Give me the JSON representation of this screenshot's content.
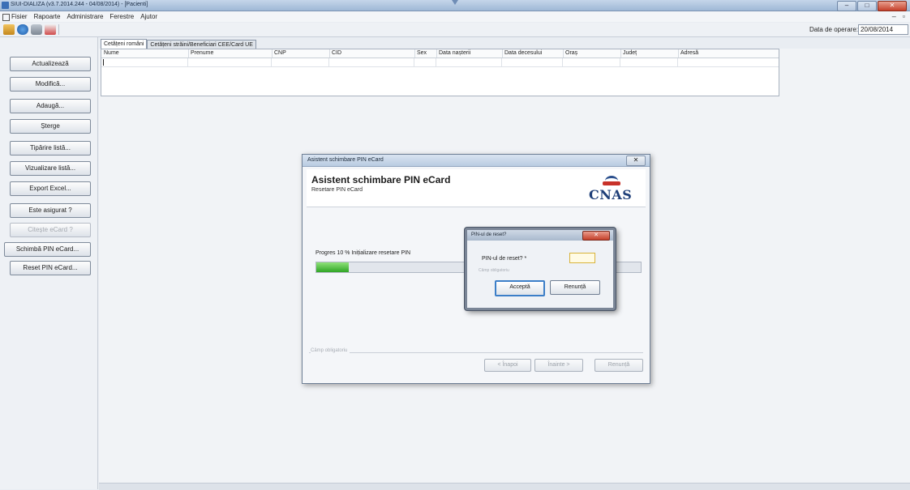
{
  "window": {
    "title": "SIUI-DIALIZA (v3.7.2014.244 - 04/08/2014) - [Pacienti]"
  },
  "menu": [
    "Fisier",
    "Rapoarte",
    "Administrare",
    "Ferestre",
    "Ajutor"
  ],
  "toolbar": {
    "operation_date_label": "Data de operare:",
    "operation_date_value": "20/08/2014"
  },
  "sidebar": {
    "items": [
      {
        "label": "Actualizează",
        "enabled": true
      },
      {
        "label": "Modifică...",
        "enabled": true
      },
      {
        "label": "Adaugă...",
        "enabled": true
      },
      {
        "label": "Șterge",
        "enabled": true
      },
      {
        "label": "Tipărire listă...",
        "enabled": true
      },
      {
        "label": "Vizualizare listă...",
        "enabled": true
      },
      {
        "label": "Export Excel...",
        "enabled": true
      },
      {
        "label": "Este asigurat ?",
        "enabled": true
      },
      {
        "label": "Citește eCard ?",
        "enabled": false
      },
      {
        "label": "Schimbă PIN eCard...",
        "enabled": true
      },
      {
        "label": "Reset PIN eCard...",
        "enabled": true
      }
    ]
  },
  "tabs": [
    {
      "label": "Cetățeni români",
      "active": true
    },
    {
      "label": "Cetățeni străini/Beneficiari CEE/Card UE",
      "active": false
    }
  ],
  "grid": {
    "columns": [
      "Nume",
      "Prenume",
      "CNP",
      "CID",
      "Sex",
      "Data nașterii",
      "Data decesului",
      "Oraș",
      "Județ",
      "Adresă"
    ]
  },
  "wizard": {
    "window_title": "Asistent schimbare PIN eCard",
    "heading": "Asistent schimbare PIN eCard",
    "subheading": "Resetare PIN eCard",
    "logo_text": "CNAS",
    "progress_label": "Progres 10 % Inițializare resetare PIN",
    "progress_percent": 10,
    "footer_label": "Câmp obligatoriu",
    "buttons": {
      "back": "< Înapoi",
      "next": "Înainte >",
      "cancel": "Renunță"
    }
  },
  "pin_dialog": {
    "title": "PIN-ul de reset?",
    "label": "PIN-ul de reset? *",
    "value": "",
    "hint": "Câmp obligatoriu",
    "buttons": {
      "accept": "Acceptă",
      "cancel": "Renunță"
    }
  },
  "colors": {
    "progress": "#2fa524",
    "close_button": "#c5412b"
  }
}
